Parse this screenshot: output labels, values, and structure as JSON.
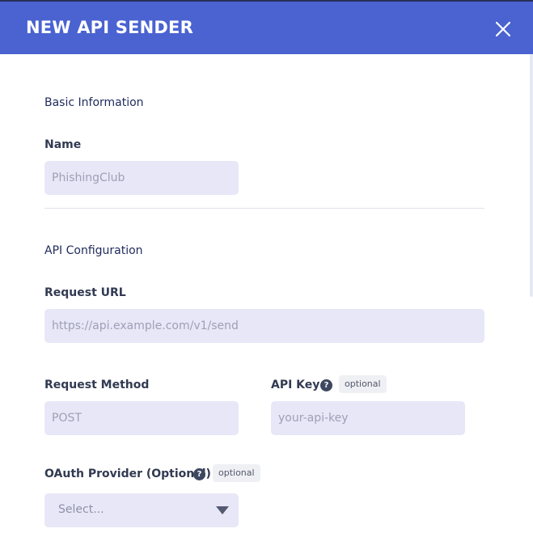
{
  "modal": {
    "title": "NEW API SENDER",
    "close_icon": "close-icon"
  },
  "basic": {
    "section_title": "Basic Information",
    "name_label": "Name",
    "name_placeholder": "PhishingClub"
  },
  "api": {
    "section_title": "API Configuration",
    "url_label": "Request URL",
    "url_placeholder": "https://api.example.com/v1/send",
    "method_label": "Request Method",
    "method_placeholder": "POST",
    "key_label": "API Key",
    "key_help": "?",
    "key_badge": "optional",
    "key_placeholder": "your-api-key"
  },
  "oauth": {
    "label": "OAuth Provider (Optional)",
    "help": "?",
    "badge": "optional",
    "select_value": "Select..."
  },
  "colors": {
    "header_bg": "#4a63d1",
    "input_bg": "#e8e7f7",
    "section_title": "#1f2a5c"
  }
}
